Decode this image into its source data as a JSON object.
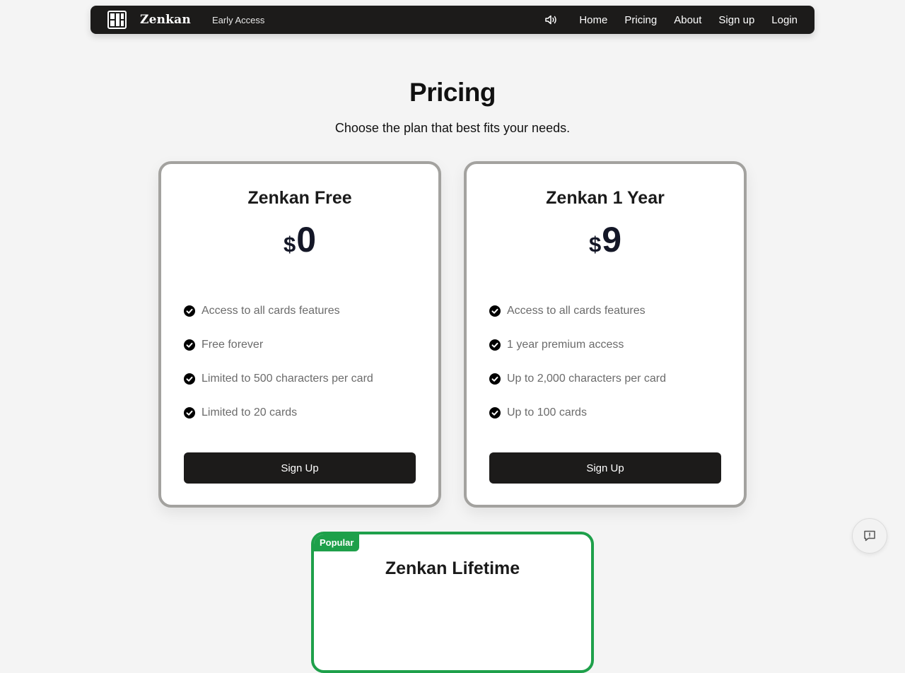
{
  "nav": {
    "brand": "Zenkan",
    "badge": "Early Access",
    "links": [
      "Home",
      "Pricing",
      "About",
      "Sign up",
      "Login"
    ]
  },
  "header": {
    "title": "Pricing",
    "subtitle": "Choose the plan that best fits your needs."
  },
  "plans": [
    {
      "name": "Zenkan Free",
      "currency": "$",
      "price": "0",
      "features": [
        "Access to all cards features",
        "Free forever",
        "Limited to 500 characters per card",
        "Limited to 20 cards"
      ],
      "button": "Sign Up"
    },
    {
      "name": "Zenkan 1 Year",
      "currency": "$",
      "price": "9",
      "features": [
        "Access to all cards features",
        "1 year premium access",
        "Up to 2,000 characters per card",
        "Up to 100 cards"
      ],
      "button": "Sign Up"
    },
    {
      "name": "Zenkan Lifetime",
      "badge": "Popular"
    }
  ],
  "colors": {
    "nav_bg": "#1c1b1a",
    "button_bg": "#1c1b1a",
    "card_border": "#a3a29f",
    "popular_accent": "#1ea04a",
    "page_bg": "#f4f4f4"
  },
  "icons": {
    "logo": "grid-logo-icon",
    "sound": "speaker-icon",
    "check": "check-circle-icon",
    "feedback": "feedback-icon"
  }
}
